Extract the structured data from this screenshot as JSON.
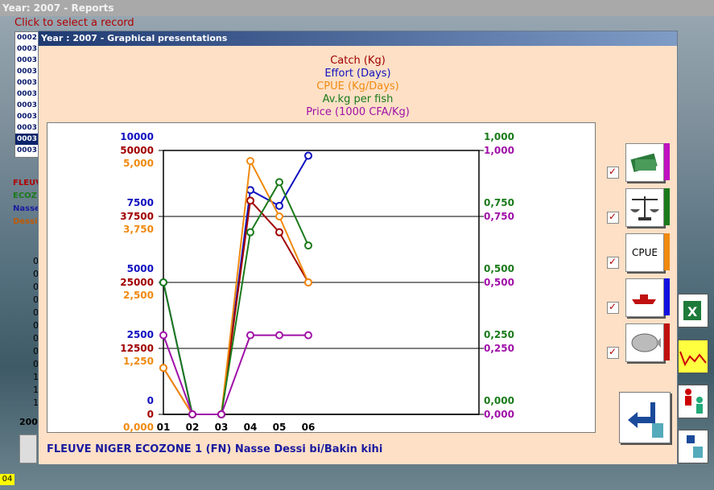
{
  "main_window": {
    "title": "Year: 2007 - Reports",
    "hint": "Click to select a record"
  },
  "records": [
    "0002",
    "0003",
    "0003",
    "0003",
    "0003",
    "0003",
    "0003",
    "0003",
    "0003",
    "0003",
    "0003"
  ],
  "selected_record_index": 9,
  "labels": [
    "FLEUV",
    "ECOZ",
    "Nasse",
    "Dessi"
  ],
  "label_colors": [
    "#b00000",
    "#1a7a1a",
    "#1a1aa0",
    "#c05800"
  ],
  "col_values": [
    "0",
    "0",
    "0",
    "0",
    "0",
    "0",
    "0",
    "0",
    "0",
    "1",
    "1",
    "1"
  ],
  "year_label": "200",
  "status": "04",
  "dialog": {
    "title": "Year : 2007 - Graphical presentations",
    "legend": [
      {
        "text": "Catch (Kg)",
        "color": "#a00000"
      },
      {
        "text": "Effort (Days)",
        "color": "#1010c0"
      },
      {
        "text": "CPUE (Kg/Days)",
        "color": "#f08a10"
      },
      {
        "text": "Av.kg per fish",
        "color": "#1a7a1a"
      },
      {
        "text": "Price (1000 CFA/Kg)",
        "color": "#a010a8"
      }
    ],
    "footer": "FLEUVE NIGER ECOZONE 1 (FN) Nasse Dessi bi/Bakin kihi",
    "buttons": [
      {
        "name": "catch",
        "color": "#c010c0"
      },
      {
        "name": "av-weight",
        "color": "#1a7a1a"
      },
      {
        "name": "cpue",
        "label": "CPUE",
        "color": "#f08a10"
      },
      {
        "name": "effort",
        "color": "#1010e0"
      },
      {
        "name": "price",
        "color": "#c01010"
      }
    ],
    "checkbox_mark": "✓"
  },
  "chart_data": {
    "type": "line",
    "categories": [
      "01",
      "02",
      "03",
      "04",
      "05",
      "06"
    ],
    "series": [
      {
        "name": "Effort (Days)",
        "color": "#1010c0",
        "values": [
          5000,
          0,
          0,
          8500,
          7900,
          9800
        ]
      },
      {
        "name": "Catch (Kg)",
        "color": "#a00000",
        "values": [
          8800,
          0,
          0,
          40500,
          34500,
          25000
        ]
      },
      {
        "name": "CPUE (Kg/Days)",
        "color": "#f08a10",
        "values": [
          880,
          0,
          0,
          4800,
          3750,
          2500
        ]
      },
      {
        "name": "Av.kg per fish",
        "color": "#1a7a1a",
        "values": [
          0.5,
          0,
          0,
          0.69,
          0.88,
          0.64
        ]
      },
      {
        "name": "Price (1000 CFA/Kg)",
        "color": "#a010a8",
        "values": [
          0.3,
          0,
          0,
          0.3,
          0.3,
          0.3
        ]
      }
    ],
    "left_axes": [
      {
        "color": "#1010c0",
        "ticks": [
          "10000",
          "7500",
          "5000",
          "2500",
          "0"
        ]
      },
      {
        "color": "#a00000",
        "ticks": [
          "50000",
          "37500",
          "25000",
          "12500",
          "0"
        ]
      },
      {
        "color": "#f08a10",
        "ticks": [
          "5,000",
          "3,750",
          "2,500",
          "1,250",
          "0,000"
        ]
      }
    ],
    "right_axes": [
      {
        "color": "#1a7a1a",
        "ticks": [
          "1,000",
          "0,750",
          "0,500",
          "0,250",
          "0,000"
        ]
      },
      {
        "color": "#a010a8",
        "ticks": [
          "1,000",
          "0,750",
          "0,500",
          "0,250",
          "0,000"
        ]
      }
    ],
    "ylim_effort": [
      0,
      10000
    ],
    "ylim_catch": [
      0,
      50000
    ],
    "ylim_cpue": [
      0,
      5000
    ],
    "ylim_av": [
      0,
      1
    ],
    "ylim_price": [
      0,
      1
    ],
    "grid": true
  }
}
